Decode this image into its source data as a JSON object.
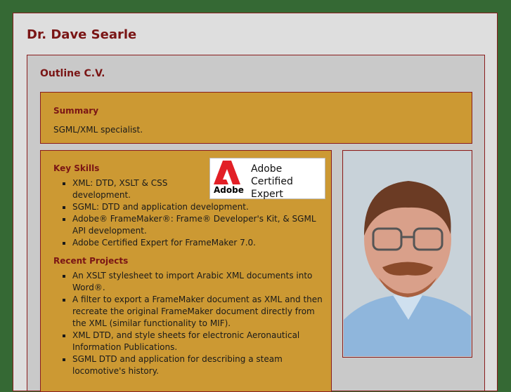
{
  "site": {
    "title": "Dr. Dave Searle"
  },
  "outline": {
    "title": "Outline C.V."
  },
  "summary": {
    "heading": "Summary",
    "text": "SGML/XML specialist."
  },
  "skills": {
    "heading": "Key Skills",
    "items": [
      "XML: DTD, XSLT & CSS development.",
      "SGML: DTD and application development.",
      "Adobe® FrameMaker®: Frame® Developer's Kit, & SGML API development.",
      "Adobe Certified Expert for FrameMaker 7.0."
    ]
  },
  "projects": {
    "heading": "Recent Projects",
    "items": [
      "An XSLT stylesheet to import Arabic XML documents into Word®.",
      "A filter to export a FrameMaker document as XML and then recreate the original FrameMaker document directly from the XML (similar functionality to MIF).",
      "XML DTD, and style sheets for electronic Aeronautical Information Publications.",
      "SGML DTD and application for describing a steam locomotive's history."
    ]
  },
  "ace": {
    "logo_word": "Adobe",
    "line1": "Adobe",
    "line2": "Certified Expert"
  },
  "colors": {
    "background": "#356934",
    "accent": "#7a1515",
    "box": "#cc9933"
  }
}
